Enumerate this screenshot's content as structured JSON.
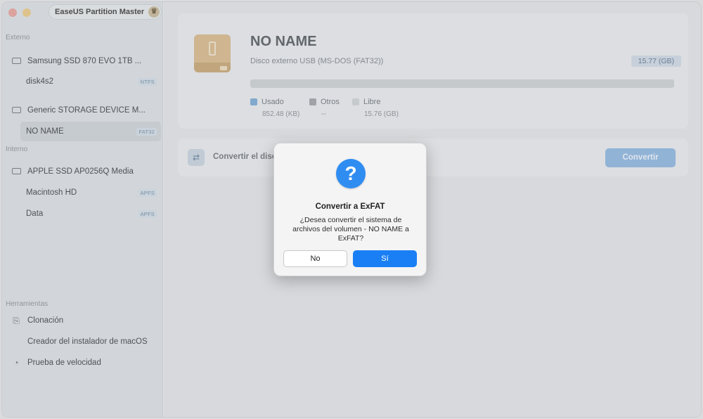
{
  "app": {
    "title": "EaseUS Partition Master"
  },
  "sidebar": {
    "external_label": "Externo",
    "internal_label": "Interno",
    "tools_label": "Herramientas",
    "external": [
      {
        "label": "Samsung SSD 870 EVO 1TB ...",
        "children": [
          {
            "label": "disk4s2",
            "badge": "NTFS"
          }
        ]
      },
      {
        "label": "Generic STORAGE DEVICE M...",
        "children": [
          {
            "label": "NO NAME",
            "badge": "FAT32",
            "selected": true
          }
        ]
      }
    ],
    "internal": [
      {
        "label": "APPLE SSD AP0256Q Media",
        "children": [
          {
            "label": "Macintosh HD",
            "badge": "APFS"
          },
          {
            "label": "Data",
            "badge": "APFS"
          }
        ]
      }
    ],
    "tools": [
      {
        "label": "Clonación",
        "icon": "clone-icon"
      },
      {
        "label": "Creador del instalador de macOS",
        "icon": "apple-icon"
      },
      {
        "label": "Prueba de velocidad",
        "icon": "speedometer-icon"
      }
    ]
  },
  "disk": {
    "name": "NO NAME",
    "subtitle": "Disco externo USB (MS-DOS (FAT32))",
    "size": "15.77 (GB)",
    "used_fraction": 0.0,
    "legend": [
      {
        "label": "Usado",
        "value": "852.48 (KB)",
        "color": "#7aaad6"
      },
      {
        "label": "Otros",
        "value": "--",
        "color": "#9fa2a5"
      },
      {
        "label": "Libre",
        "value": "15.76 (GB)",
        "color": "#d0d2d4"
      }
    ]
  },
  "convert": {
    "label": "Convertir el disco",
    "button": "Convertir"
  },
  "dialog": {
    "title": "Convertir a ExFAT",
    "message": "¿Desea convertir el sistema de archivos del volumen - NO NAME a ExFAT?",
    "no": "No",
    "yes": "Sí"
  }
}
